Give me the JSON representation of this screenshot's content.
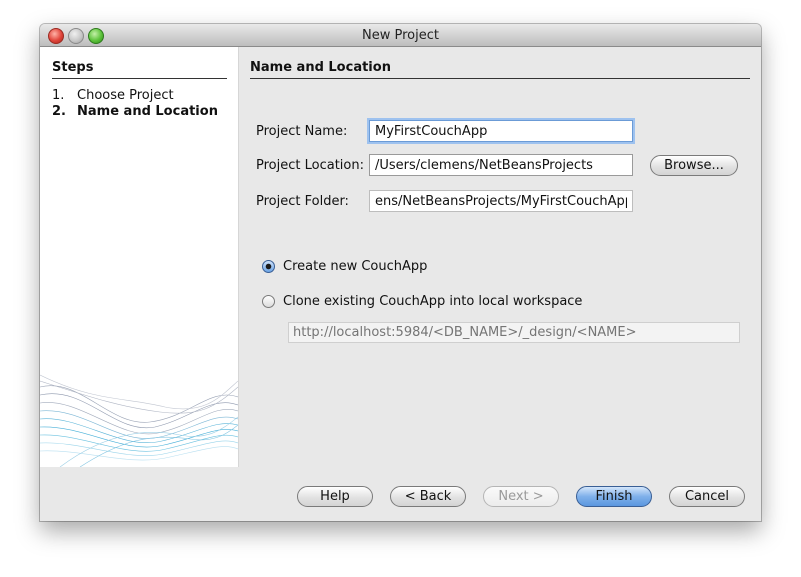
{
  "window": {
    "title": "New Project"
  },
  "sidebar": {
    "heading": "Steps",
    "steps": [
      {
        "number": "1.",
        "label": "Choose Project",
        "current": false
      },
      {
        "number": "2.",
        "label": "Name and Location",
        "current": true
      }
    ]
  },
  "panel": {
    "heading": "Name and Location",
    "project_name": {
      "label": "Project Name:",
      "value": "MyFirstCouchApp"
    },
    "project_location": {
      "label": "Project Location:",
      "value": "/Users/clemens/NetBeansProjects"
    },
    "project_folder": {
      "label": "Project Folder:",
      "value": "ens/NetBeansProjects/MyFirstCouchApp"
    },
    "browse_label": "Browse...",
    "options": {
      "create_new": {
        "label": "Create new CouchApp",
        "selected": true
      },
      "clone_existing": {
        "label": "Clone existing CouchApp into local workspace",
        "selected": false
      }
    },
    "clone_url_placeholder": "http://localhost:5984/<DB_NAME>/_design/<NAME>"
  },
  "footer": {
    "help_label": "Help",
    "back_label": "< Back",
    "next_label": "Next >",
    "finish_label": "Finish",
    "cancel_label": "Cancel"
  }
}
